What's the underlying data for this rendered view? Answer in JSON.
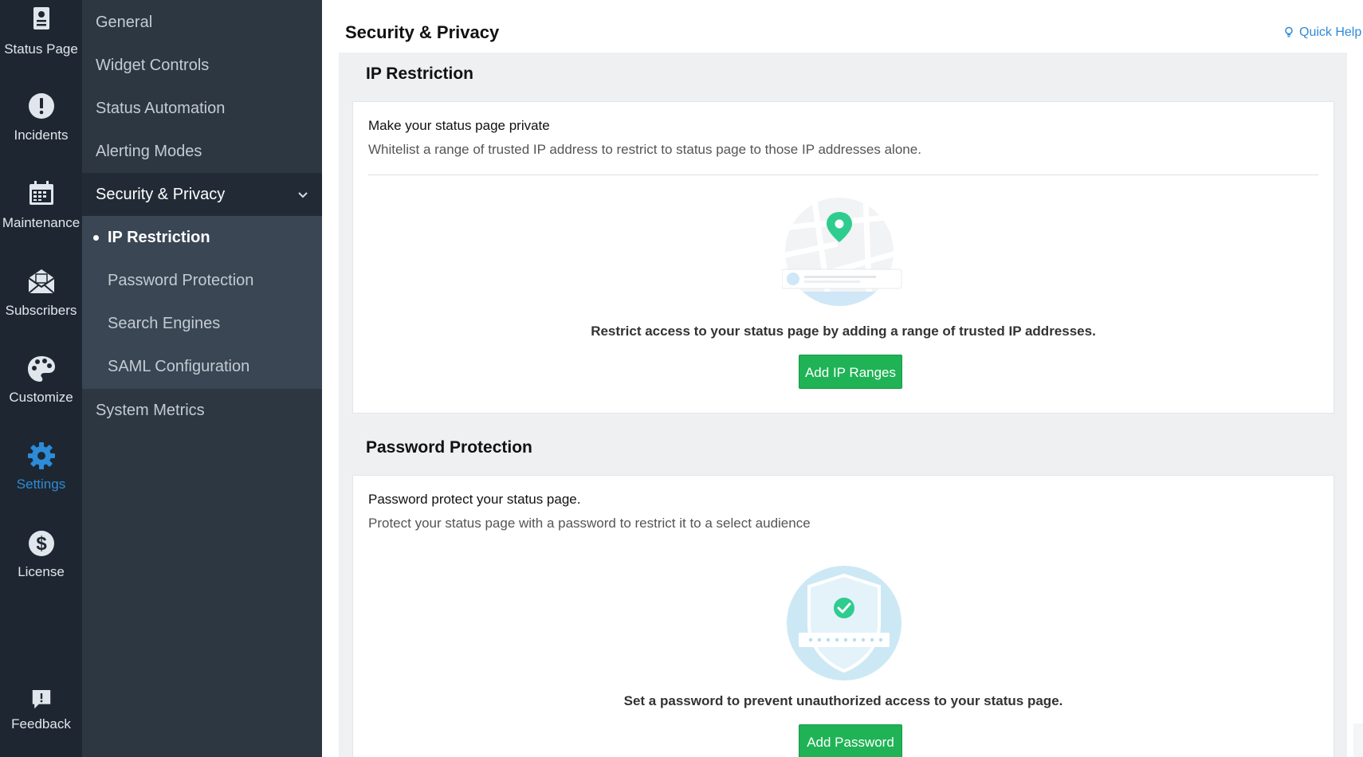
{
  "rail": {
    "items": [
      {
        "label": "Status Page",
        "icon": "status-page-icon"
      },
      {
        "label": "Incidents",
        "icon": "exclamation-circle-icon"
      },
      {
        "label": "Maintenance",
        "icon": "calendar-icon"
      },
      {
        "label": "Subscribers",
        "icon": "envelope-icon"
      },
      {
        "label": "Customize",
        "icon": "palette-icon"
      },
      {
        "label": "Settings",
        "icon": "gear-icon",
        "active": true
      },
      {
        "label": "License",
        "icon": "dollar-icon"
      }
    ],
    "feedback": {
      "label": "Feedback",
      "icon": "feedback-icon"
    },
    "active_color": "#2d8bd8"
  },
  "sidebar": {
    "items": [
      {
        "label": "General"
      },
      {
        "label": "Widget Controls"
      },
      {
        "label": "Status Automation"
      },
      {
        "label": "Alerting Modes"
      },
      {
        "label": "Security & Privacy",
        "expanded": true
      },
      {
        "label": "System Metrics"
      }
    ],
    "subitems": [
      {
        "label": "IP Restriction",
        "active": true
      },
      {
        "label": "Password Protection"
      },
      {
        "label": "Search Engines"
      },
      {
        "label": "SAML Configuration"
      }
    ]
  },
  "main": {
    "title": "Security & Privacy",
    "quick_help": "Quick Help",
    "sections": [
      {
        "title": "IP Restriction",
        "heading": "Make your status page private",
        "description": "Whitelist a range of trusted IP address to restrict to status page to those IP addresses alone.",
        "message": "Restrict access to your status page by adding a range of trusted IP addresses.",
        "button": "Add IP Ranges",
        "illustration": "map-pin-illustration"
      },
      {
        "title": "Password Protection",
        "heading": "Password protect your status page.",
        "description": "Protect your status page with a password to restrict it to a select audience",
        "message": "Set a password to prevent unauthorized access to your status page.",
        "button": "Add Password",
        "illustration": "shield-password-illustration"
      }
    ]
  },
  "colors": {
    "primary_button": "#1fb355",
    "accent": "#2d8bd8",
    "illustration_green": "#2ecc8f",
    "illustration_blue": "#cde8f5"
  }
}
